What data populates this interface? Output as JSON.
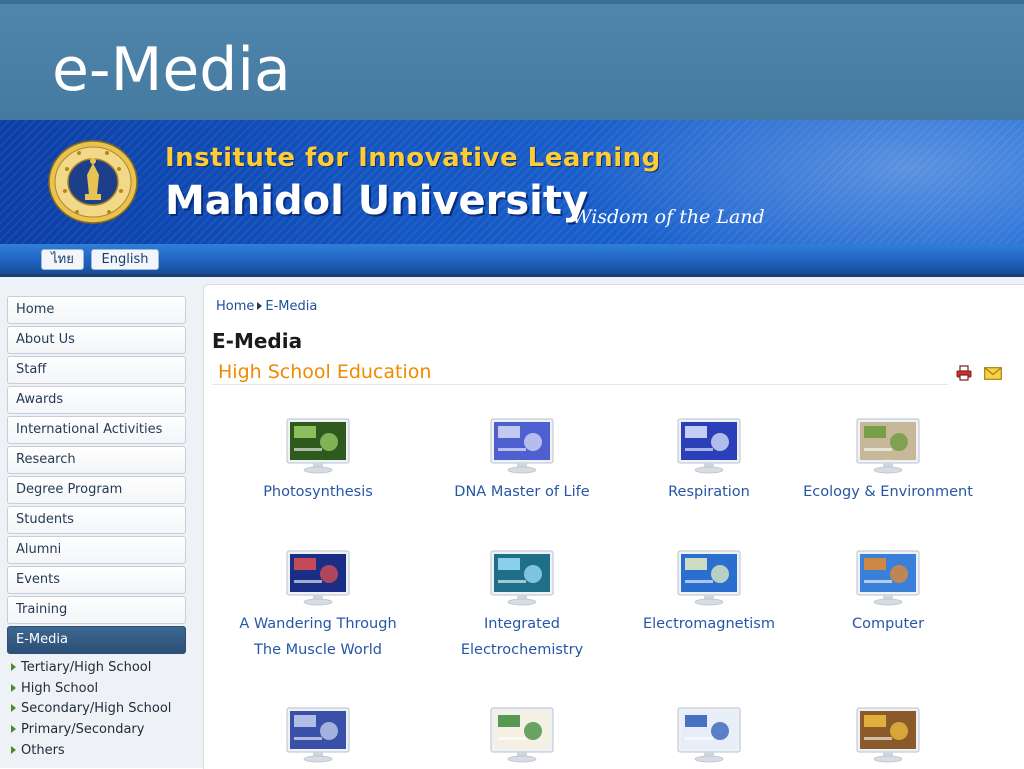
{
  "slide": {
    "title": "e-Media"
  },
  "header": {
    "institute": "Institute for Innovative Learning",
    "university": "Mahidol University",
    "tagline": "Wisdom of the Land"
  },
  "lang": {
    "thai": "ไทย",
    "english": "English"
  },
  "nav": {
    "items": [
      "Home",
      "About Us",
      "Staff",
      "Awards",
      "International Activities",
      "Research",
      "Degree Program",
      "Students",
      "Alumni",
      "Events",
      "Training",
      "E-Media"
    ],
    "active": "E-Media",
    "subitems": [
      "Tertiary/High School",
      "High School",
      "Secondary/High School",
      "Primary/Secondary",
      "Others"
    ]
  },
  "breadcrumb": [
    "Home",
    "E-Media"
  ],
  "main": {
    "heading": "E-Media",
    "section": "High School Education",
    "items": [
      {
        "line1": "Photosynthesis",
        "line2": "",
        "thumb_bg": "#2f5a1e",
        "thumb_accent": "#9dd06a"
      },
      {
        "line1": "DNA Master of Life",
        "line2": "",
        "thumb_bg": "#4e5fd0",
        "thumb_accent": "#d8dcf5"
      },
      {
        "line1": "Respiration",
        "line2": "",
        "thumb_bg": "#2a3fb8",
        "thumb_accent": "#dfe7ff"
      },
      {
        "line1": "Ecology & Environment",
        "line2": "",
        "thumb_bg": "#c8b89a",
        "thumb_accent": "#6a9a3a"
      },
      {
        "line1": "A Wandering Through",
        "line2": "The Muscle World",
        "thumb_bg": "#1b2e86",
        "thumb_accent": "#e05050"
      },
      {
        "line1": "Integrated",
        "line2": "Electrochemistry",
        "thumb_bg": "#1f6f8a",
        "thumb_accent": "#9fe0ff"
      },
      {
        "line1": "Electromagnetism",
        "line2": "",
        "thumb_bg": "#2a6fd0",
        "thumb_accent": "#e8f0c0"
      },
      {
        "line1": "Computer",
        "line2": "",
        "thumb_bg": "#3a7fd8",
        "thumb_accent": "#e88a2a"
      },
      {
        "line1": "",
        "line2": "",
        "thumb_bg": "#3a4fa8",
        "thumb_accent": "#c8d0f0"
      },
      {
        "line1": "",
        "line2": "",
        "thumb_bg": "#f4f0e4",
        "thumb_accent": "#3a8a3a"
      },
      {
        "line1": "",
        "line2": "",
        "thumb_bg": "#e8eef8",
        "thumb_accent": "#2a5ab8"
      },
      {
        "line1": "",
        "line2": "",
        "thumb_bg": "#8a5a2a",
        "thumb_accent": "#f0c040"
      }
    ]
  },
  "colors": {
    "title_bar": "#4a7fa5",
    "banner": "#1456c2",
    "institute_text": "#ffcc33",
    "link": "#2656a8",
    "section_title": "#f08a00",
    "nav_active": "#2b4f77"
  },
  "icons": [
    "university-seal",
    "printer-icon",
    "mail-icon",
    "arrow-right-icon",
    "monitor-thumbnail"
  ]
}
